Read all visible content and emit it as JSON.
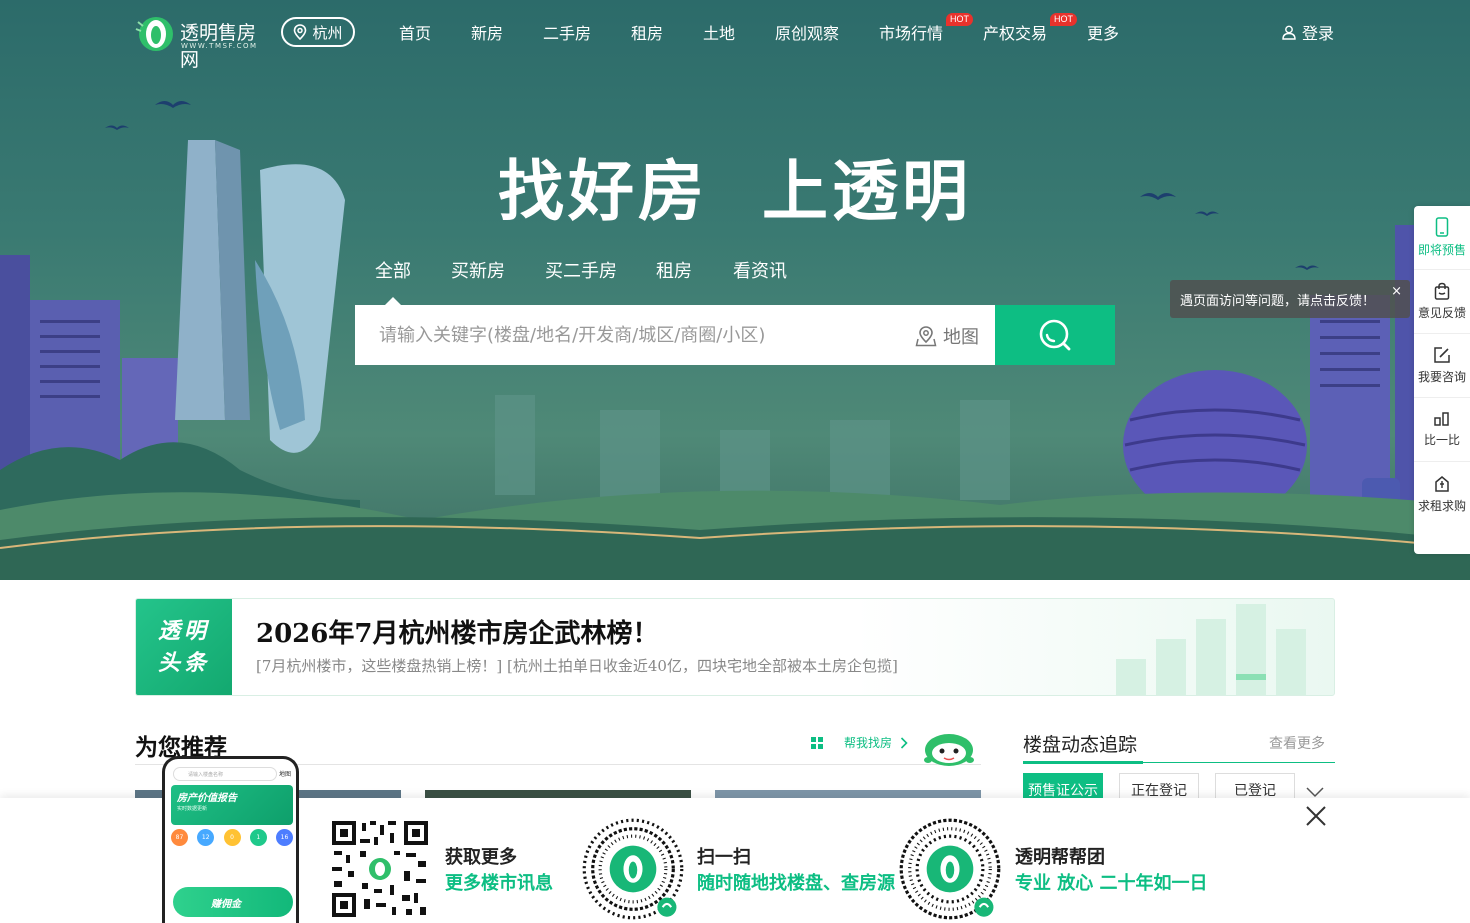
{
  "colors": {
    "accent": "#0dbe83",
    "hot": "#e8322c",
    "hero_bg": "#3a7a72"
  },
  "nav": {
    "logo_name": "透明售房网",
    "logo_sub": "WWW.TMSF.COM",
    "city": "杭州",
    "items": [
      {
        "label": "首页"
      },
      {
        "label": "新房"
      },
      {
        "label": "二手房"
      },
      {
        "label": "租房"
      },
      {
        "label": "土地"
      },
      {
        "label": "原创观察"
      },
      {
        "label": "市场行情",
        "badge": "HOT"
      },
      {
        "label": "产权交易",
        "badge": "HOT"
      },
      {
        "label": "更多"
      }
    ],
    "login": "登录"
  },
  "hero": {
    "slogan": "找好房  上透明",
    "tabs": [
      "全部",
      "买新房",
      "买二手房",
      "租房",
      "看资讯"
    ],
    "search_placeholder": "请输入关键字(楼盘/地名/开发商/城区/商圈/小区)",
    "map_label": "地图"
  },
  "sidebar": {
    "items": [
      {
        "label": "即将预售",
        "icon": "phone-icon"
      },
      {
        "label": "意见反馈",
        "icon": "bag-icon"
      },
      {
        "label": "我要咨询",
        "icon": "edit-icon"
      },
      {
        "label": "比一比",
        "icon": "compare-icon"
      },
      {
        "label": "求租求购",
        "icon": "house-icon"
      }
    ],
    "tooltip": "遇页面访问等问题，请点击反馈！",
    "tooltip_close": "×"
  },
  "headline": {
    "tag_line1": "透明",
    "tag_line2": "头条",
    "title": "2026年7月杭州楼市房企武林榜！",
    "sub": "[7月杭州楼市，这些楼盘热销上榜！] [杭州土拍单日收金近40亿，四块宅地全部被本土房企包揽]"
  },
  "recommend": {
    "title": "为您推荐",
    "help": "帮我找房"
  },
  "tracking": {
    "title": "楼盘动态追踪",
    "more": "查看更多",
    "tabs": [
      "预售证公示",
      "正在登记",
      "已登记"
    ]
  },
  "bottom": {
    "items": [
      {
        "title": "获取更多",
        "sub": "更多楼市讯息"
      },
      {
        "title": "扫一扫",
        "sub": "随时随地找楼盘、查房源"
      },
      {
        "title": "透明帮帮团",
        "sub": "专业 放心 二十年如一日"
      }
    ],
    "phone": {
      "search_placeholder": "请输入楼盘名称",
      "corner": "地图",
      "banner": "房产价值报告",
      "banner_sub": "实时数据更新",
      "stats": [
        "87",
        "12",
        "0",
        "1",
        "16"
      ],
      "promo": "赚佣金"
    }
  }
}
